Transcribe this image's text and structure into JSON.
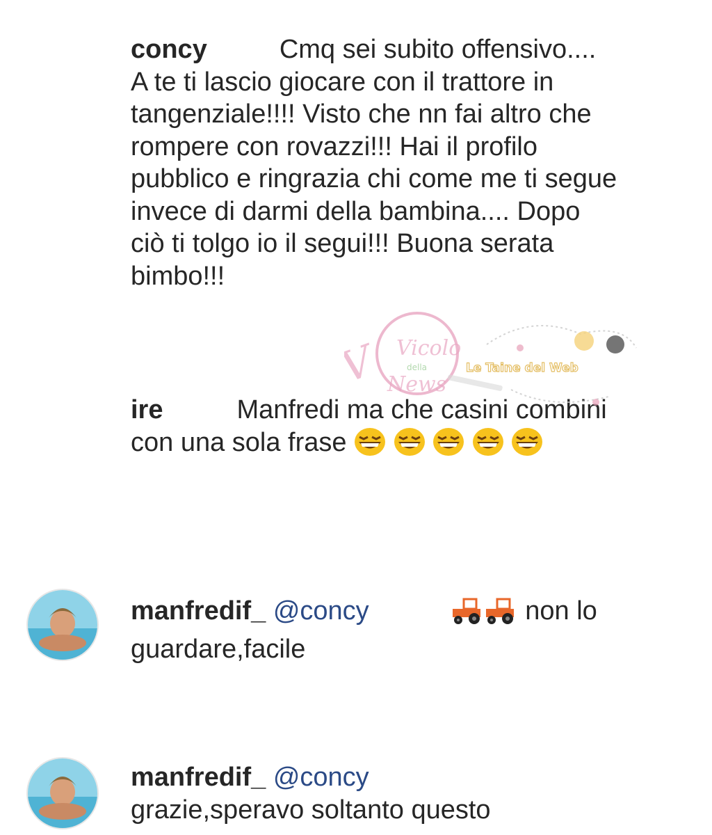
{
  "comments": [
    {
      "username": "concy",
      "text": "Cmq sei subito offensivo.... A te ti lascio giocare con il trattore in tangenziale!!!! Visto che nn fai altro che rompere con rovazzi!!! Hai il profilo pubblico e ringrazia chi come me ti segue invece di darmi della bambina.... Dopo ciò ti tolgo io il segui!!! Buona serata bimbo!!!"
    },
    {
      "username": "ire",
      "text": "Manfredi ma che casini combini con una sola frase",
      "emojis": [
        "grinning-squinting-face",
        "grinning-squinting-face",
        "grinning-squinting-face",
        "grinning-squinting-face",
        "grinning-squinting-face"
      ]
    },
    {
      "username": "manfredif_",
      "mention": "@concy",
      "text_after": "non lo guardare,facile",
      "emojis": [
        "tractor",
        "tractor"
      ]
    },
    {
      "username": "manfredif_",
      "mention": "@concy",
      "text": "grazie,speravo soltanto questo"
    }
  ],
  "watermark": {
    "logo_text_1": "Vicolo",
    "logo_text_2": "della",
    "logo_text_3": "News",
    "banner_text": "Le Taine del Web"
  },
  "colors": {
    "text": "#262626",
    "mention": "#2b4a86",
    "emoji_face": "#f7c21d",
    "tractor": "#e8672a",
    "watermark_pink": "#e9a6c2"
  }
}
